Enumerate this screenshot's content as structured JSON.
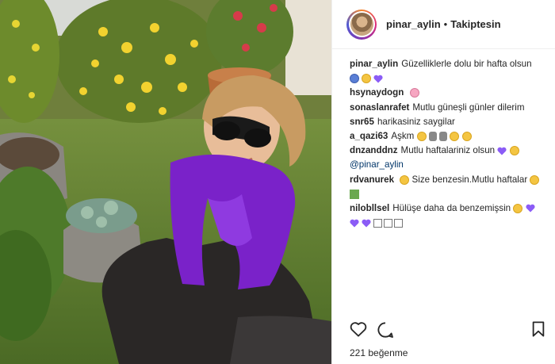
{
  "header": {
    "username": "pinar_aylin",
    "separator": "•",
    "follow_status": "Takiptesin"
  },
  "comments": [
    {
      "user": "pinar_aylin",
      "text": "Güzelliklerle dolu bir hafta olsun"
    },
    {
      "user": "hsynaydogn",
      "text": ""
    },
    {
      "user": "sonaslanrafet",
      "text": "Mutlu güneşli günler dilerim"
    },
    {
      "user": "snr65",
      "text": "harikasiniz saygilar"
    },
    {
      "user": "a_qazi63",
      "text": "Aşkm"
    },
    {
      "user": "dnzanddnz",
      "text": "Mutlu haftalariniz olsun",
      "mention": "@pinar_aylin"
    },
    {
      "user": "rdvanurek",
      "text": "Size benzesin.Mutlu haftalar"
    },
    {
      "user": "nilobllsel",
      "text": "Hülüşe daha da benzemişsin"
    }
  ],
  "likes": {
    "count": "221",
    "label": "beğenme"
  },
  "colors": {
    "purple_heart": "#8b5cf6",
    "scarf": "#7a22c9"
  },
  "icons": [
    "heart-icon",
    "comment-icon",
    "bookmark-icon"
  ]
}
